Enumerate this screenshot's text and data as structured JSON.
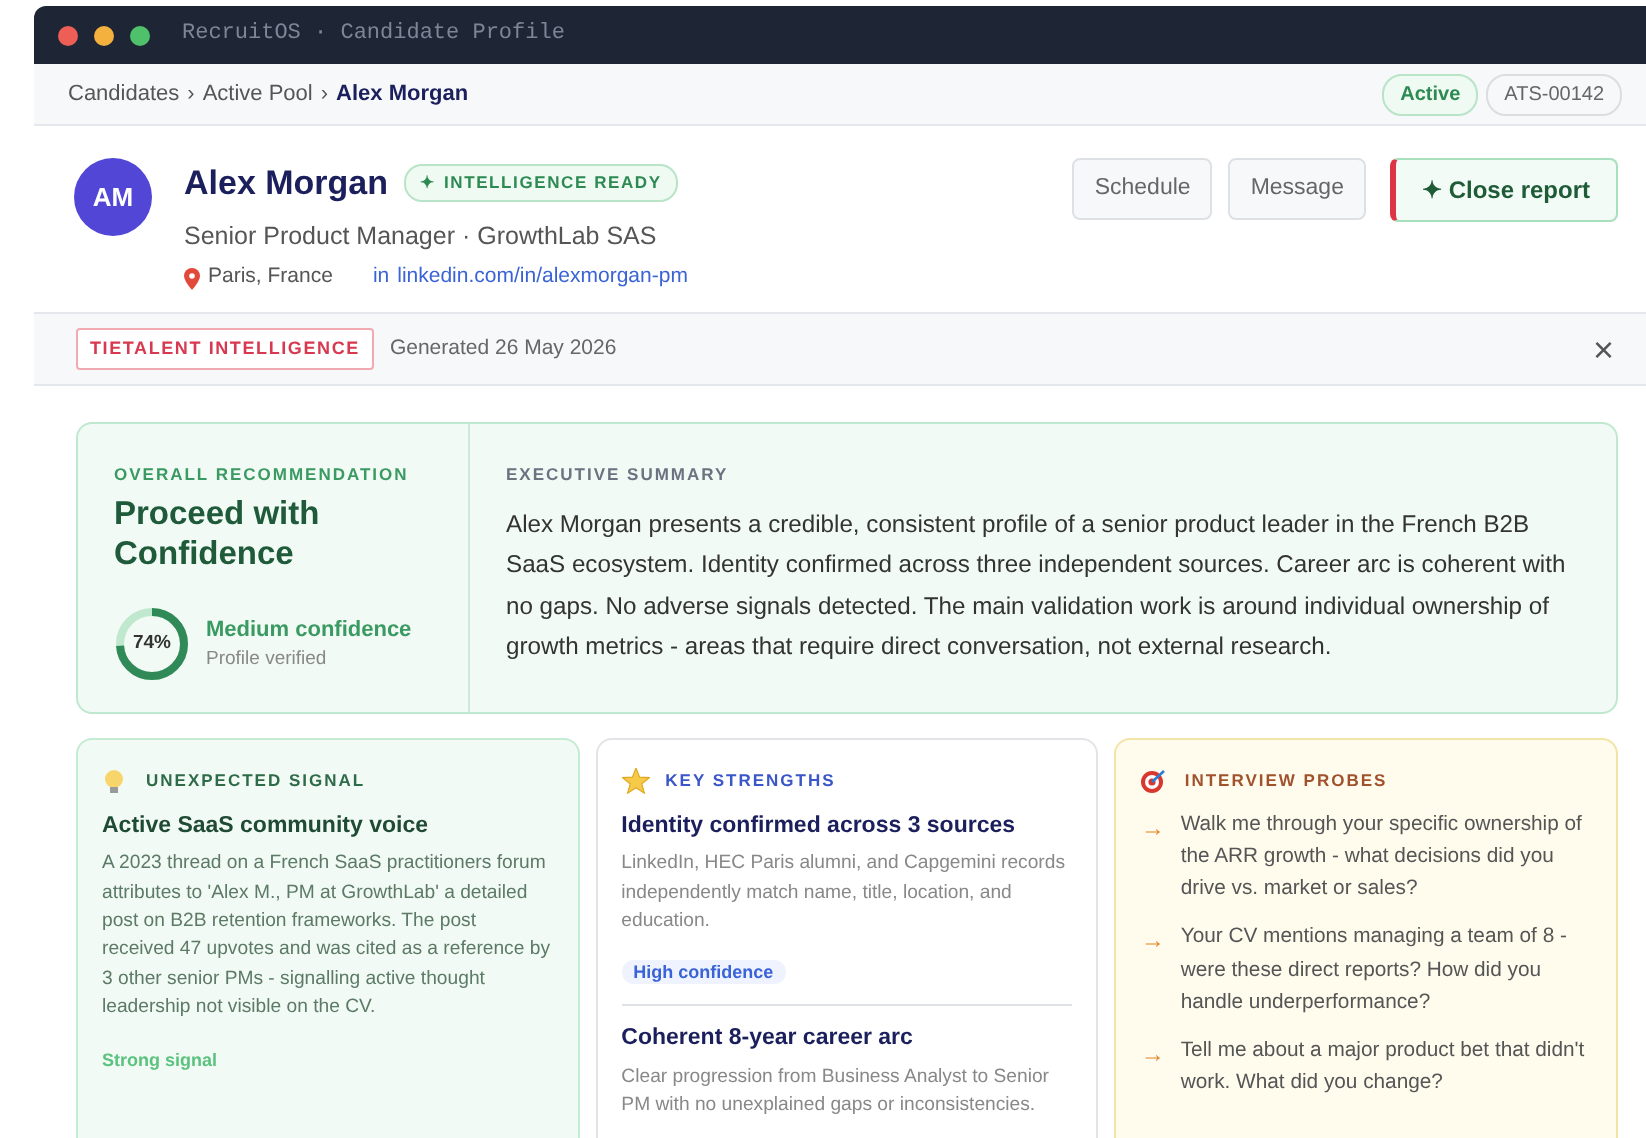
{
  "window": {
    "title": "RecruitOS · Candidate Profile"
  },
  "breadcrumb": {
    "items": [
      {
        "label": "Candidates",
        "current": false
      },
      {
        "label": "Active Pool",
        "current": false
      },
      {
        "label": "Alex Morgan",
        "current": true
      }
    ],
    "separator": "›"
  },
  "status_badge": "Active",
  "record_id": "ATS-00142",
  "candidate": {
    "initials": "AM",
    "name": "Alex Morgan",
    "badge": "✦ INTELLIGENCE READY",
    "title": "Senior Product Manager · GrowthLab SAS",
    "location": "Paris, France",
    "linkedin_prefix": "in",
    "linkedin": "linkedin.com/in/alexmorgan-pm"
  },
  "actions": [
    {
      "label": "Schedule",
      "kind": "plain"
    },
    {
      "label": "Message",
      "kind": "plain"
    },
    {
      "label": "✦ Close report",
      "kind": "accent"
    }
  ],
  "report_bar": {
    "tag": "TIETALENT INTELLIGENCE",
    "generated": "Generated 26 May 2026",
    "close": "×"
  },
  "recommendation": {
    "heading": "OVERALL RECOMMENDATION",
    "verdict": "Proceed with Confidence",
    "score": "74%",
    "level": 0.74,
    "confidence": "Medium confidence",
    "note": "Profile verified"
  },
  "summary": {
    "heading": "EXECUTIVE SUMMARY",
    "text": "Alex Morgan presents a credible, consistent profile of a senior product leader in the French B2B SaaS ecosystem. Identity confirmed across three independent sources. Career arc is coherent with no gaps. No adverse signals detected. The main validation work is around individual ownership of growth metrics - areas that require direct conversation, not external research."
  },
  "panels": [
    {
      "kind": "signal",
      "heading": "UNEXPECTED SIGNAL",
      "items": [
        {
          "title": "Active SaaS community voice",
          "text": "A 2023 thread on a French SaaS practitioners forum attributes to 'Alex M., PM at GrowthLab' a detailed post on B2B retention frameworks. The post received 47 upvotes and was cited as a reference by 3 other senior PMs - signalling active thought leadership not visible on the CV.",
          "tag": "Strong signal"
        }
      ]
    },
    {
      "kind": "strengths",
      "heading": "KEY STRENGTHS",
      "items": [
        {
          "title": "Identity confirmed across 3 sources",
          "text": "LinkedIn, HEC Paris alumni, and Capgemini records independently match name, title, location, and education.",
          "tag": "High confidence"
        },
        {
          "title": "Coherent 8-year career arc",
          "text": "Clear progression from Business Analyst to Senior PM with no unexplained gaps or inconsistencies."
        }
      ]
    },
    {
      "kind": "probes",
      "heading": "INTERVIEW PROBES",
      "bullet": "→",
      "items": [
        {
          "text": "Walk me through your specific ownership of the ARR growth - what decisions did you drive vs. market or sales?"
        },
        {
          "text": "Your CV mentions managing a team of 8 - were these direct reports? How did you handle underperformance?"
        },
        {
          "text": "Tell me about a major product bet that didn't work. What did you change?"
        }
      ]
    }
  ]
}
